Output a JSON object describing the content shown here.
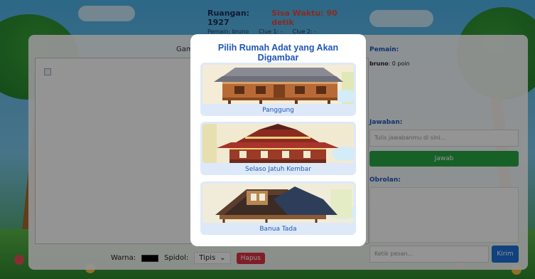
{
  "header": {
    "room_label": "Ruangan: 1927",
    "time_label": "Sisa Waktu: 90 detik",
    "player_label": "Pemain: bruno",
    "clue1": "Clue 1: -",
    "clue2": "Clue 2: -"
  },
  "canvas": {
    "label": "Gam"
  },
  "tools": {
    "color_label": "Warna:",
    "brush_label": "Spidol:",
    "brush_value": "Tipis",
    "erase_label": "Hapus"
  },
  "side": {
    "players_title": "Pemain:",
    "player_name": "bruno",
    "player_points": ": 0 poin",
    "answer_title": "Jawaban:",
    "answer_placeholder": "Tulis jawabanmu di sini...",
    "answer_button": "Jawab",
    "chat_title": "Obrolan:",
    "chat_placeholder": "Ketik pesan...",
    "send_button": "Kirim"
  },
  "modal": {
    "title": "Pilih Rumah Adat yang Akan Digambar",
    "options": [
      {
        "label": "Panggung"
      },
      {
        "label": "Selaso Jatuh Kembar"
      },
      {
        "label": "Banua Tada"
      }
    ]
  },
  "colors": {
    "accent": "#1f56b8",
    "answer_button": "#28a745",
    "send_button": "#1a73d9",
    "erase_button": "#dc3545",
    "time_text": "#e74c3c"
  }
}
